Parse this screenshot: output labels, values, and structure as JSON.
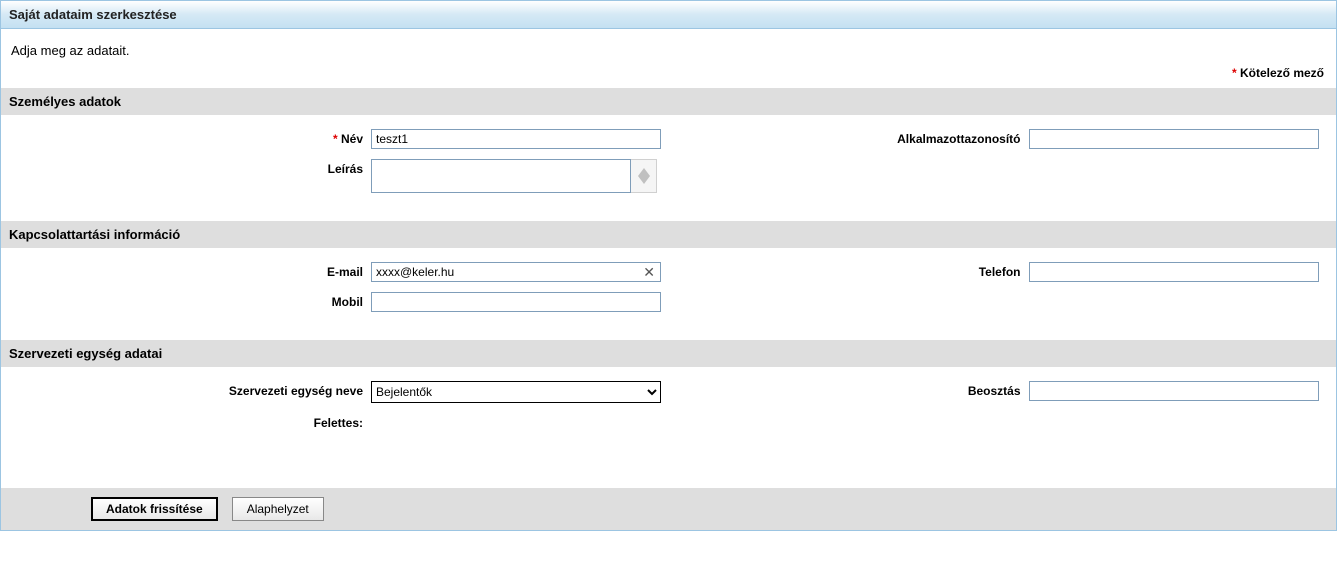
{
  "header": {
    "title": "Saját adataim szerkesztése"
  },
  "instruction": "Adja meg az adatait.",
  "required_note": "Kötelező mező",
  "sections": {
    "personal": {
      "title": "Személyes adatok",
      "name_label": "Név",
      "name_value": "teszt1",
      "description_label": "Leírás",
      "description_value": "",
      "employee_id_label": "Alkalmazottazonosító",
      "employee_id_value": ""
    },
    "contact": {
      "title": "Kapcsolattartási információ",
      "email_label": "E-mail",
      "email_value": "xxxx@keler.hu",
      "mobile_label": "Mobil",
      "mobile_value": "",
      "phone_label": "Telefon",
      "phone_value": ""
    },
    "org": {
      "title": "Szervezeti egység adatai",
      "unit_label": "Szervezeti egység neve",
      "unit_value": "Bejelentők",
      "role_label": "Beosztás",
      "role_value": "",
      "manager_label": "Felettes:",
      "manager_value": ""
    }
  },
  "buttons": {
    "update": "Adatok frissítése",
    "reset": "Alaphelyzet"
  }
}
